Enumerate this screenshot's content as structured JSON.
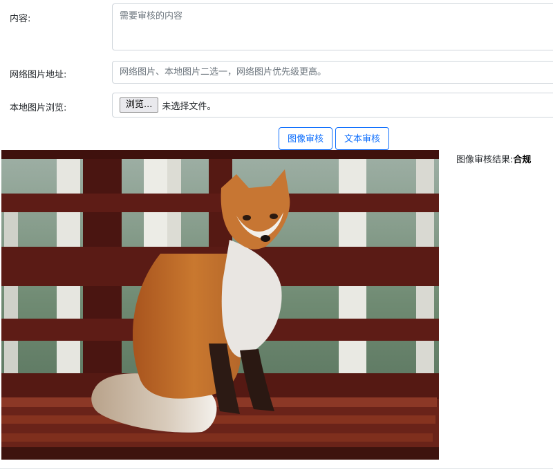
{
  "form": {
    "content_label": "内容:",
    "content_placeholder": "需要审核的内容",
    "url_label": "网络图片地址:",
    "url_placeholder": "网络图片、本地图片二选一，网络图片优先级更高。",
    "local_label": "本地图片浏览:",
    "browse_label": "浏览...",
    "file_status": "未选择文件。"
  },
  "actions": {
    "image_check_label": "图像审核",
    "text_check_label": "文本审核"
  },
  "result": {
    "label": "图像审核结果:",
    "value": "合规"
  },
  "colors": {
    "accent": "#0d6efd",
    "border": "#ced4da",
    "deck_wood": "#5e1c16"
  }
}
